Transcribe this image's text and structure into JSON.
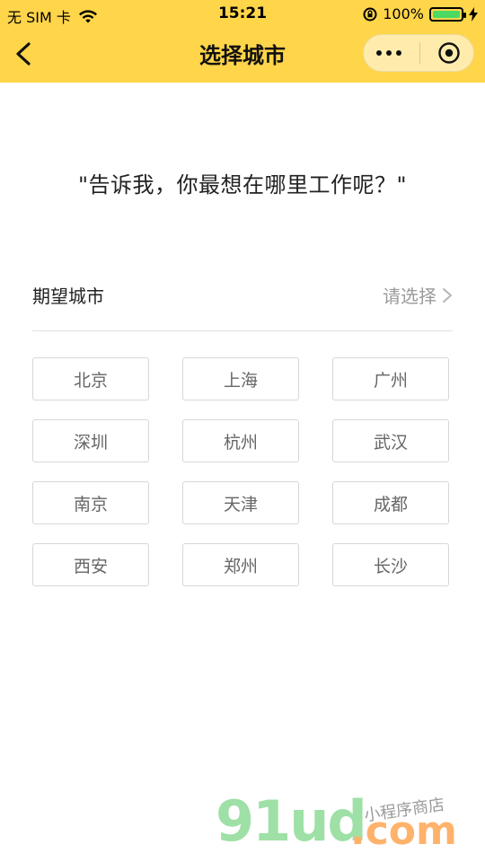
{
  "status_bar": {
    "carrier": "无 SIM 卡",
    "time": "15:21",
    "battery_percent": "100%"
  },
  "nav": {
    "title": "选择城市"
  },
  "content": {
    "quote": "\"告诉我，你最想在哪里工作呢？\"",
    "expect_label": "期望城市",
    "expect_placeholder": "请选择"
  },
  "cities": [
    "北京",
    "上海",
    "广州",
    "深圳",
    "杭州",
    "武汉",
    "南京",
    "天津",
    "成都",
    "西安",
    "郑州",
    "长沙"
  ],
  "watermark": {
    "big": "91ud",
    "dot_com": ".com",
    "small": "小程序商店"
  },
  "colors": {
    "header_yellow": "#FFD54A",
    "battery_green": "#4CD964",
    "border_gray": "#d7d7d7",
    "text_gray": "#9a9a9a"
  }
}
